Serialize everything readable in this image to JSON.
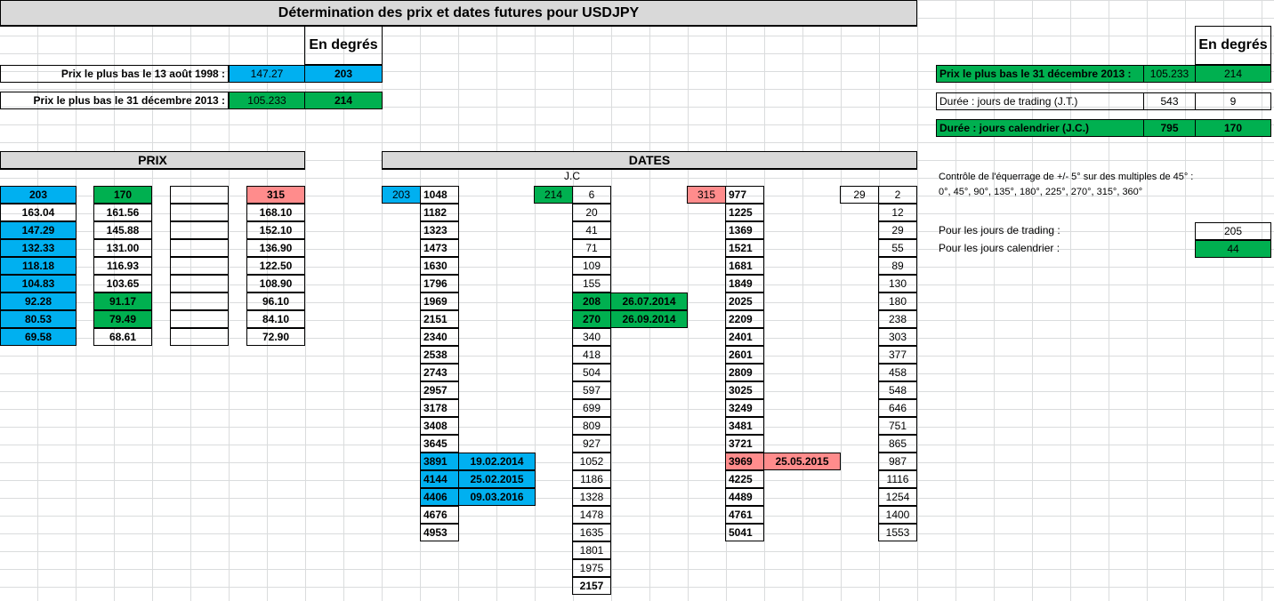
{
  "title": "Détermination des prix et dates futures pour USDJPY",
  "en_degres": "En degrés",
  "left": {
    "low1998_label": "Prix le plus bas le 13 août 1998 :",
    "low1998_price": "147.27",
    "low1998_deg": "203",
    "low2013_label": "Prix le plus bas le 31 décembre 2013 :",
    "low2013_price": "105.233",
    "low2013_deg": "214"
  },
  "right": {
    "low2013_label": "Prix le plus bas le 31 décembre 2013 :",
    "low2013_price": "105.233",
    "low2013_deg": "214",
    "jt_label": "Durée : jours de trading  (J.T.)",
    "jt_value": "543",
    "jt_deg": "9",
    "jc_label": "Durée : jours calendrier  (J.C.)",
    "jc_value": "795",
    "jc_deg": "170",
    "note1": "Contrôle de l'équerrage de +/- 5° sur des multiples de 45° :",
    "note2": "0°, 45°, 90°, 135°, 180°, 225°, 270°, 315°, 360°",
    "trading_label": "Pour les jours de trading :",
    "trading_value": "205",
    "calendar_label": "Pour les jours calendrier :",
    "calendar_value": "44"
  },
  "prix": {
    "header": "PRIX",
    "col1": [
      "203",
      "163.04",
      "147.29",
      "132.33",
      "118.18",
      "104.83",
      "92.28",
      "80.53",
      "69.58"
    ],
    "col2": [
      "170",
      "161.56",
      "145.88",
      "131.00",
      "116.93",
      "103.65",
      "91.17",
      "79.49",
      "68.61"
    ],
    "col4": [
      "315",
      "168.10",
      "152.10",
      "136.90",
      "122.50",
      "108.90",
      "96.10",
      "84.10",
      "72.90"
    ]
  },
  "dates": {
    "header": "DATES",
    "jc_label": "J.C",
    "c1_head": "203",
    "c1": [
      "1048",
      "1182",
      "1323",
      "1473",
      "1630",
      "1796",
      "1969",
      "2151",
      "2340",
      "2538",
      "2743",
      "2957",
      "3178",
      "3408",
      "3645",
      "3891",
      "4144",
      "4406",
      "4676",
      "4953"
    ],
    "c1_dates": {
      "15": "19.02.2014",
      "16": "25.02.2015",
      "17": "09.03.2016"
    },
    "c2_head": "214",
    "c2": [
      "6",
      "20",
      "41",
      "71",
      "109",
      "155",
      "208",
      "270",
      "340",
      "418",
      "504",
      "597",
      "699",
      "809",
      "927",
      "1052",
      "1186",
      "1328",
      "1478",
      "1635",
      "1801",
      "1975",
      "2157"
    ],
    "c2_dates": {
      "6": "26.07.2014",
      "7": "26.09.2014"
    },
    "c3_head": "315",
    "c3": [
      "977",
      "1225",
      "1369",
      "1521",
      "1681",
      "1849",
      "2025",
      "2209",
      "2401",
      "2601",
      "2809",
      "3025",
      "3249",
      "3481",
      "3721",
      "3969",
      "4225",
      "4489",
      "4761",
      "5041"
    ],
    "c3_dates": {
      "15": "25.05.2015"
    },
    "c4_head": "29",
    "c4": [
      "2",
      "12",
      "29",
      "55",
      "89",
      "130",
      "180",
      "238",
      "303",
      "377",
      "458",
      "548",
      "646",
      "751",
      "865",
      "987",
      "1116",
      "1254",
      "1400",
      "1553"
    ]
  },
  "colors": {
    "blue": "#00b0f0",
    "green": "#00b050",
    "salmon": "#ff8c8c",
    "gray": "#d9d9d9"
  }
}
